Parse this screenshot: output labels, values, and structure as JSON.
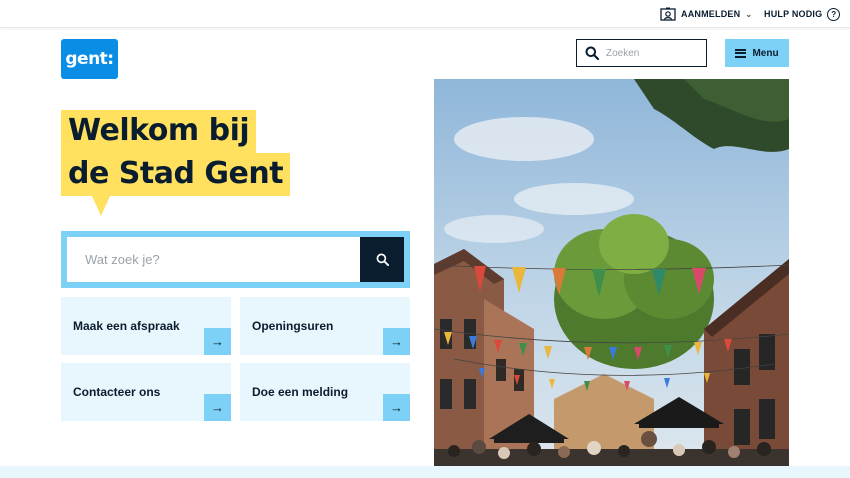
{
  "topbar": {
    "login_label": "AANMELDEN",
    "help_label": "HULP NODIG",
    "help_symbol": "?"
  },
  "logo": {
    "text": "gent:",
    "color": "#0a8de5"
  },
  "header": {
    "search_placeholder": "Zoeken",
    "menu_label": "Menu",
    "menu_color": "#7dd1f7"
  },
  "hero": {
    "title_line1": "Welkom bij",
    "title_line2": "de Stad Gent",
    "highlight_color": "#ffe15f",
    "search_placeholder": "Wat zoek je?"
  },
  "quick_links": [
    {
      "label": "Maak een afspraak",
      "icon": "arrow-right-icon"
    },
    {
      "label": "Openingsuren",
      "icon": "arrow-right-icon"
    },
    {
      "label": "Contacteer ons",
      "icon": "arrow-right-icon"
    },
    {
      "label": "Doe een melding",
      "icon": "arrow-right-icon"
    }
  ],
  "arrow_glyph": "→"
}
